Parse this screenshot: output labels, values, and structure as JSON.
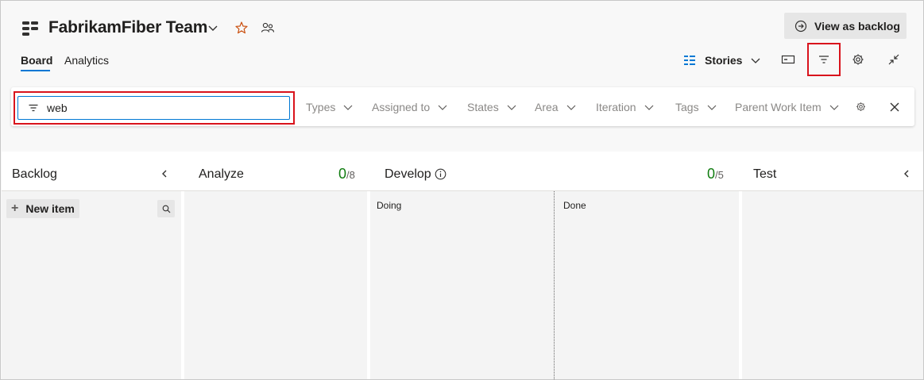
{
  "header": {
    "team_name": "FabrikamFiber Team",
    "view_backlog_label": "View as backlog"
  },
  "tabs": [
    {
      "label": "Board",
      "selected": true
    },
    {
      "label": "Analytics",
      "selected": false
    }
  ],
  "toolbar": {
    "backlog_level": "Stories"
  },
  "filter_bar": {
    "keyword_value": "web",
    "filters": [
      "Types",
      "Assigned to",
      "States",
      "Area",
      "Iteration",
      "Tags",
      "Parent Work Item"
    ]
  },
  "board": {
    "columns": [
      {
        "name": "Backlog"
      },
      {
        "name": "Analyze",
        "count": "0",
        "limit": "/8"
      },
      {
        "name": "Develop",
        "count": "0",
        "limit": "/5",
        "sub_columns": [
          "Doing",
          "Done"
        ]
      },
      {
        "name": "Test"
      }
    ],
    "new_item_label": "New item"
  },
  "colors": {
    "accent": "#0078d4",
    "highlight": "#d9131c",
    "count_ok": "#107c10",
    "star": "#ca5010"
  },
  "icons": [
    "team-icon",
    "chevron-down-icon",
    "star-icon",
    "team-members-icon",
    "arrow-circle-right-icon",
    "backlog-icon",
    "card-icon",
    "filter-icon",
    "gear-icon",
    "collapse-icon",
    "close-icon",
    "info-icon",
    "plus-icon",
    "search-icon",
    "chevron-left-icon"
  ]
}
